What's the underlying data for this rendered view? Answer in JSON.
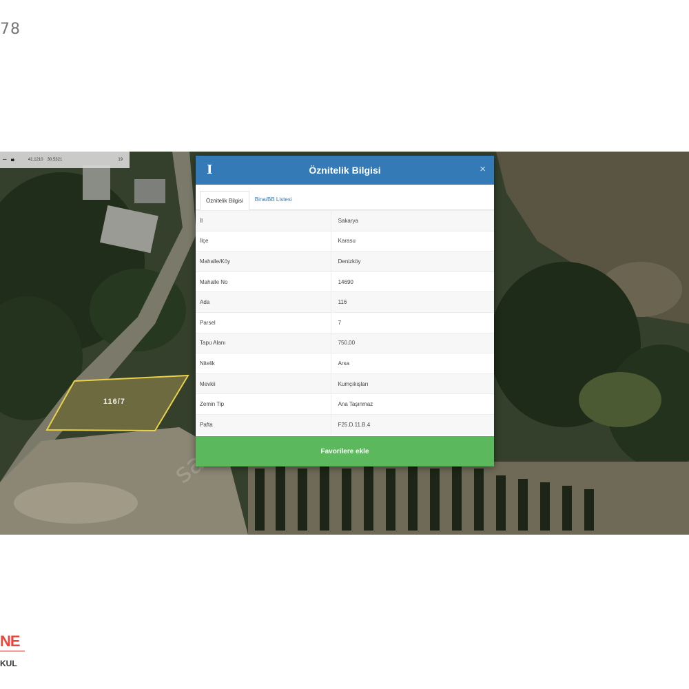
{
  "page": {
    "corner_number": "78"
  },
  "map": {
    "toolbar": {
      "coord_lat": "41.1210",
      "coord_lon": "30.5321",
      "zoom": "19"
    },
    "parcel_label": "116/7",
    "watermark": "sah"
  },
  "modal": {
    "title": "Öznitelik Bilgisi",
    "close_symbol": "×",
    "info_symbol": "I",
    "tabs": [
      {
        "label": "Öznitelik Bilgisi",
        "active": true
      },
      {
        "label": "Bina/BB Listesi",
        "active": false
      }
    ],
    "rows": [
      {
        "key": "İl",
        "value": "Sakarya"
      },
      {
        "key": "İlçe",
        "value": "Karasu"
      },
      {
        "key": "Mahalle/Köy",
        "value": "Denizköy"
      },
      {
        "key": "Mahalle No",
        "value": "14690"
      },
      {
        "key": "Ada",
        "value": "116"
      },
      {
        "key": "Parsel",
        "value": "7"
      },
      {
        "key": "Tapu Alanı",
        "value": "750,00"
      },
      {
        "key": "Nitelik",
        "value": "Arsa"
      },
      {
        "key": "Mevkii",
        "value": "Kumçıkışları"
      },
      {
        "key": "Zemin Tip",
        "value": "Ana Taşınmaz"
      },
      {
        "key": "Pafta",
        "value": "F25.D.11.B.4"
      }
    ],
    "favorite_button": "Favorilere ekle"
  },
  "logo": {
    "brand": "NE",
    "sub": "KUL"
  },
  "colors": {
    "header_blue": "#337ab7",
    "button_green": "#5cb85c",
    "parcel_outline": "#e9d24a",
    "logo_red": "#e8463c"
  },
  "icons": {
    "info": "info-icon",
    "close": "close-icon",
    "lock": "lock-icon",
    "minus": "minus-icon"
  }
}
